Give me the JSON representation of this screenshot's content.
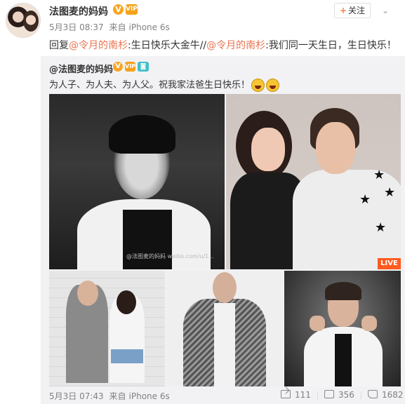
{
  "post": {
    "author": "法图麦的妈妈",
    "badges": [
      "V",
      "VIP"
    ],
    "date": "5月3日 08:37",
    "source_prefix": "来自",
    "source": "iPhone 6s",
    "follow_label": "关注",
    "follow_plus": "+",
    "dropdown_icon": "chevron-down-icon",
    "reply": {
      "prefix": "回复",
      "mention1": "@令月的南杉",
      "text1": ":生日快乐大金牛//",
      "mention2": "@令月的南杉",
      "text2": ":我们同一天生日，生日快乐！"
    }
  },
  "repost": {
    "author": "@法图麦的妈妈",
    "badges": [
      "V",
      "VIP",
      "camera"
    ],
    "text": "为人子、为人夫、为人父。祝我家法爸生日快乐！",
    "emoji": "laughing-emoji",
    "live_label": "LIVE",
    "watermark": "@法图麦的妈妈 weibo.com/u/1...",
    "date": "5月3日 07:43",
    "source_prefix": "来自",
    "source": "iPhone 6s",
    "actions": {
      "share_count": "111",
      "comment_count": "356",
      "like_count": "1682"
    }
  },
  "colors": {
    "link": "#eb7350",
    "badge": "#f6a623",
    "live": "#ff5a1f",
    "repost_bg": "#f2f2f5"
  }
}
